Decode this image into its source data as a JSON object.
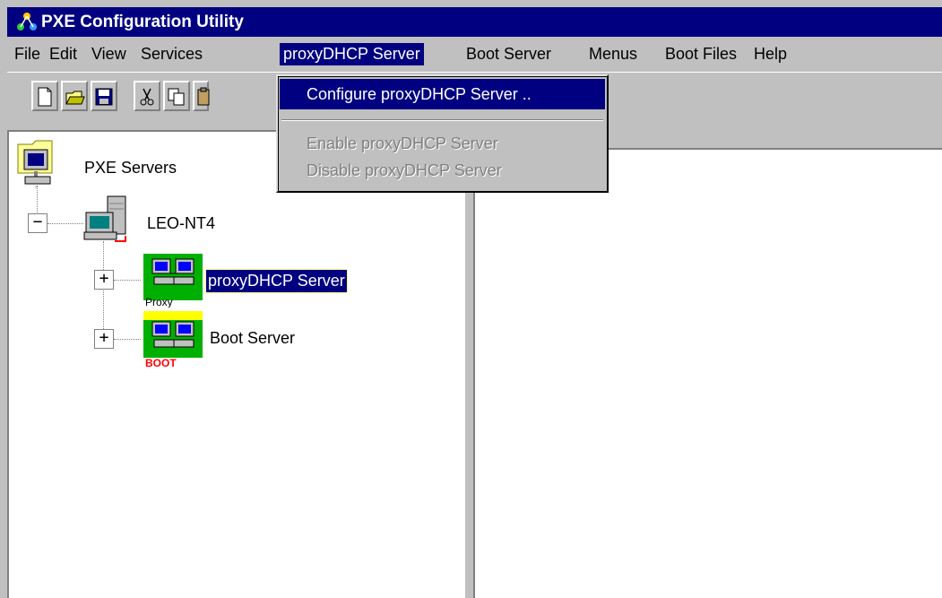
{
  "window": {
    "title": "PXE Configuration Utility"
  },
  "menubar": {
    "items": [
      {
        "label": "File"
      },
      {
        "label": "Edit"
      },
      {
        "label": "View"
      },
      {
        "label": "Services"
      },
      {
        "label": "proxyDHCP Server"
      },
      {
        "label": "Boot Server"
      },
      {
        "label": "Menus"
      },
      {
        "label": "Boot Files"
      },
      {
        "label": "Help"
      }
    ],
    "active": "proxyDHCP Server"
  },
  "toolbar": {
    "buttons": [
      "new-file-icon",
      "open-folder-icon",
      "save-icon",
      "cut-icon",
      "copy-icon",
      "paste-icon"
    ]
  },
  "dropdown": {
    "items": [
      {
        "label": "Configure proxyDHCP Server ..",
        "enabled": true
      },
      {
        "label": "Enable proxyDHCP Server",
        "enabled": false
      },
      {
        "label": "Disable proxyDHCP Server",
        "enabled": false
      }
    ]
  },
  "tree": {
    "root": {
      "label": "PXE Servers",
      "icon": "pxe-servers-icon"
    },
    "server": {
      "label": "LEO-NT4",
      "icon": "server-computer-icon",
      "expanded": true
    },
    "children": [
      {
        "label": "proxyDHCP Server",
        "icon": "proxy-network-icon",
        "icon_caption": "Proxy",
        "selected": true
      },
      {
        "label": "Boot Server",
        "icon": "boot-network-icon",
        "icon_caption": "BOOT",
        "selected": false
      }
    ]
  },
  "colors": {
    "titlebar": "#000080",
    "selection": "#000080",
    "face": "#c0c0c0"
  }
}
